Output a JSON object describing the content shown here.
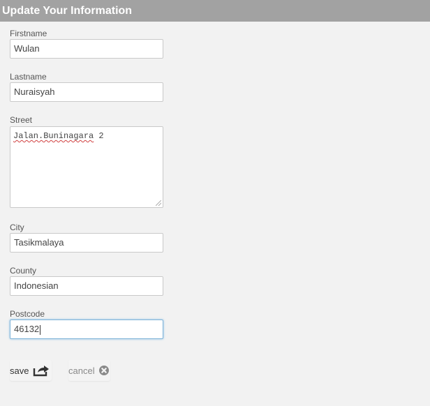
{
  "header": {
    "title": "Update Your Information"
  },
  "form": {
    "firstname": {
      "label": "Firstname",
      "value": "Wulan"
    },
    "lastname": {
      "label": "Lastname",
      "value": "Nuraisyah"
    },
    "street": {
      "label": "Street",
      "value_word1": "Jalan.Buninagara",
      "value_word2": " 2"
    },
    "city": {
      "label": "City",
      "value": "Tasikmalaya"
    },
    "county": {
      "label": "County",
      "value": "Indonesian"
    },
    "postcode": {
      "label": "Postcode",
      "value": "46132"
    }
  },
  "actions": {
    "save_label": "save",
    "cancel_label": "cancel"
  },
  "colors": {
    "header_bg": "#a2a2a2",
    "focus_border": "#7fb3d8"
  },
  "icons": {
    "save": "share-icon",
    "cancel": "cancel-circle-icon"
  }
}
